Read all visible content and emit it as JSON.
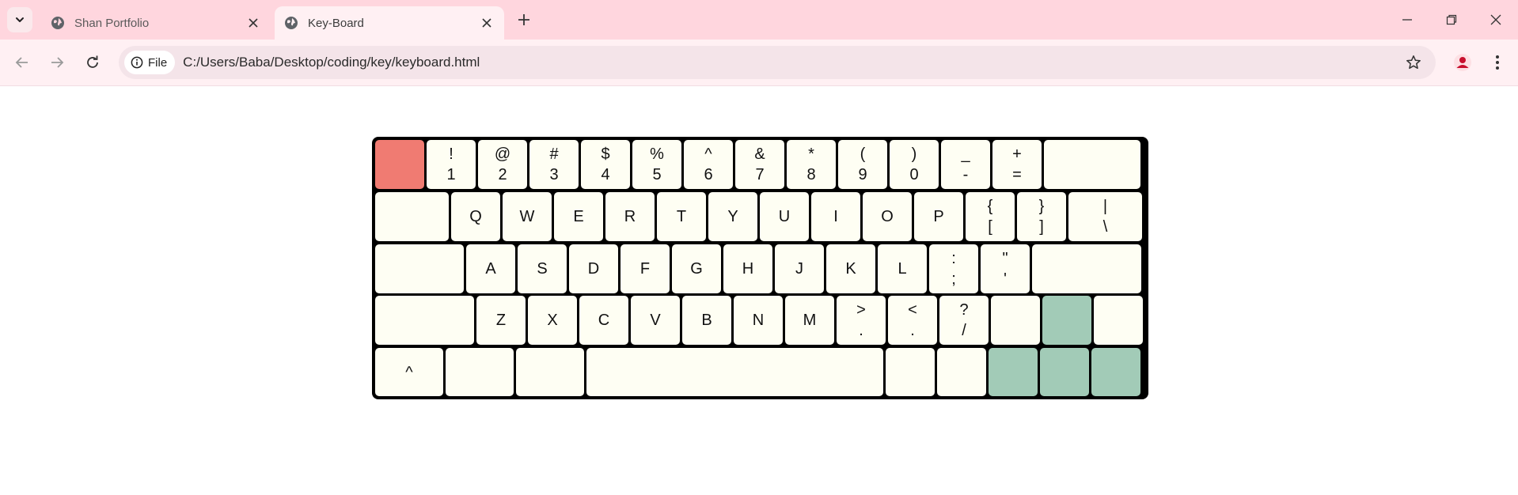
{
  "browser": {
    "tabs": [
      {
        "title": "Shan Portfolio",
        "active": false
      },
      {
        "title": "Key-Board",
        "active": true
      }
    ],
    "site_info_label": "File",
    "url": "C:/Users/Baba/Desktop/coding/key/keyboard.html",
    "icons": {
      "tab_search": "chevron-down-icon",
      "favicon": "globe-icon",
      "tab_close": "close-icon",
      "new_tab": "plus-icon",
      "back": "arrow-left-icon",
      "forward": "arrow-right-icon",
      "reload": "reload-icon",
      "site_info": "info-icon",
      "bookmark": "star-icon",
      "profile": "person-icon",
      "menu": "kebab-icon",
      "minimize": "minimize-icon",
      "restore": "restore-icon",
      "close_window": "close-icon"
    }
  },
  "keyboard": {
    "colors": {
      "frame": "#000000",
      "key": "#fefef3",
      "red": "#f07b72",
      "green": "#a2cbb7"
    },
    "rows": [
      [
        {
          "top": "",
          "bottom": "",
          "color": "red"
        },
        {
          "top": "!",
          "bottom": "1"
        },
        {
          "top": "@",
          "bottom": "2"
        },
        {
          "top": "#",
          "bottom": "3"
        },
        {
          "top": "$",
          "bottom": "4"
        },
        {
          "top": "%",
          "bottom": "5"
        },
        {
          "top": "^",
          "bottom": "6"
        },
        {
          "top": "&",
          "bottom": "7"
        },
        {
          "top": "*",
          "bottom": "8"
        },
        {
          "top": "(",
          "bottom": "9"
        },
        {
          "top": ")",
          "bottom": "0"
        },
        {
          "top": "_",
          "bottom": "-"
        },
        {
          "top": "+",
          "bottom": "="
        },
        {
          "top": "",
          "bottom": ""
        }
      ],
      [
        {
          "top": "",
          "bottom": ""
        },
        {
          "top": "Q",
          "bottom": ""
        },
        {
          "top": "W",
          "bottom": ""
        },
        {
          "top": "E",
          "bottom": ""
        },
        {
          "top": "R",
          "bottom": ""
        },
        {
          "top": "T",
          "bottom": ""
        },
        {
          "top": "Y",
          "bottom": ""
        },
        {
          "top": "U",
          "bottom": ""
        },
        {
          "top": "I",
          "bottom": ""
        },
        {
          "top": "O",
          "bottom": ""
        },
        {
          "top": "P",
          "bottom": ""
        },
        {
          "top": "{",
          "bottom": "["
        },
        {
          "top": "}",
          "bottom": "]"
        },
        {
          "top": "|",
          "bottom": "\\"
        }
      ],
      [
        {
          "top": "",
          "bottom": ""
        },
        {
          "top": "A",
          "bottom": ""
        },
        {
          "top": "S",
          "bottom": ""
        },
        {
          "top": "D",
          "bottom": ""
        },
        {
          "top": "F",
          "bottom": ""
        },
        {
          "top": "G",
          "bottom": ""
        },
        {
          "top": "H",
          "bottom": ""
        },
        {
          "top": "J",
          "bottom": ""
        },
        {
          "top": "K",
          "bottom": ""
        },
        {
          "top": "L",
          "bottom": ""
        },
        {
          "top": ":",
          "bottom": ";"
        },
        {
          "top": "\"",
          "bottom": "'"
        },
        {
          "top": "",
          "bottom": ""
        }
      ],
      [
        {
          "top": "",
          "bottom": ""
        },
        {
          "top": "Z",
          "bottom": ""
        },
        {
          "top": "X",
          "bottom": ""
        },
        {
          "top": "C",
          "bottom": ""
        },
        {
          "top": "V",
          "bottom": ""
        },
        {
          "top": "B",
          "bottom": ""
        },
        {
          "top": "N",
          "bottom": ""
        },
        {
          "top": "M",
          "bottom": ""
        },
        {
          "top": ">",
          "bottom": "."
        },
        {
          "top": "<",
          "bottom": "."
        },
        {
          "top": "?",
          "bottom": "/"
        },
        {
          "top": "",
          "bottom": ""
        },
        {
          "top": "",
          "bottom": "",
          "color": "green"
        },
        {
          "top": "",
          "bottom": ""
        }
      ],
      [
        {
          "top": "^",
          "bottom": ""
        },
        {
          "top": "",
          "bottom": ""
        },
        {
          "top": "",
          "bottom": ""
        },
        {
          "top": "",
          "bottom": ""
        },
        {
          "top": "",
          "bottom": ""
        },
        {
          "top": "",
          "bottom": ""
        },
        {
          "top": "",
          "bottom": "",
          "color": "green"
        },
        {
          "top": "",
          "bottom": "",
          "color": "green"
        },
        {
          "top": "",
          "bottom": "",
          "color": "green"
        }
      ]
    ]
  }
}
